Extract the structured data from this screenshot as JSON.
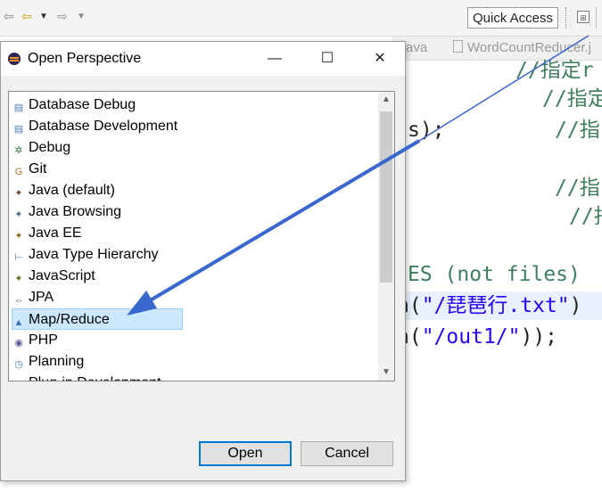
{
  "toolbar": {
    "quick_access": "Quick Access"
  },
  "editor": {
    "tabs": [
      "ava",
      "WordCountReducer.j"
    ],
    "lines": [
      {
        "text": "//指定r",
        "kind": "comment"
      },
      {
        "text": "//指定",
        "kind": "comment"
      },
      {
        "text": "s);",
        "kind": "plain"
      },
      {
        "text": "//指",
        "kind": "comment"
      },
      {
        "text": "//指",
        "kind": "comment"
      },
      {
        "text": "//指",
        "kind": "comment"
      },
      {
        "text": "ES (not files)",
        "kind": "comment"
      },
      {
        "text": "h(",
        "kind": "plain"
      },
      {
        "text": "\"/琵琶行.txt\"",
        "kind": "string"
      },
      {
        "text": ")",
        "kind": "plain"
      },
      {
        "text": "h(",
        "kind": "plain"
      },
      {
        "text": "\"/out1/\"",
        "kind": "string"
      },
      {
        "text": "));",
        "kind": "plain"
      }
    ]
  },
  "dialog": {
    "title": "Open Perspective",
    "minimize": "—",
    "maximize": "☐",
    "close": "✕",
    "perspectives": [
      {
        "label": "Database Debug",
        "icon": "database-debug-icon",
        "glyph": "▤",
        "color": "#4a7ab5"
      },
      {
        "label": "Database Development",
        "icon": "database-development-icon",
        "glyph": "▤",
        "color": "#4a7ab5"
      },
      {
        "label": "Debug",
        "icon": "bug-icon",
        "glyph": "✲",
        "color": "#3a7a3a"
      },
      {
        "label": "Git",
        "icon": "git-icon",
        "glyph": "G",
        "color": "#b07030"
      },
      {
        "label": "Java (default)",
        "icon": "java-icon",
        "glyph": "✦",
        "color": "#6b4a2a"
      },
      {
        "label": "Java Browsing",
        "icon": "java-browsing-icon",
        "glyph": "✦",
        "color": "#4a6a8a"
      },
      {
        "label": "Java EE",
        "icon": "java-ee-icon",
        "glyph": "✦",
        "color": "#8a6a2a"
      },
      {
        "label": "Java Type Hierarchy",
        "icon": "type-hierarchy-icon",
        "glyph": "⊢",
        "color": "#4a7ab5"
      },
      {
        "label": "JavaScript",
        "icon": "javascript-icon",
        "glyph": "✦",
        "color": "#6a6a2a"
      },
      {
        "label": "JPA",
        "icon": "jpa-icon",
        "glyph": "⇔",
        "color": "#555555"
      },
      {
        "label": "Map/Reduce",
        "icon": "elephant-icon",
        "glyph": "▲",
        "color": "#3b6fb6"
      },
      {
        "label": "PHP",
        "icon": "php-icon",
        "glyph": "◉",
        "color": "#5a5a9a"
      },
      {
        "label": "Planning",
        "icon": "planning-icon",
        "glyph": "◷",
        "color": "#3a7ab5"
      },
      {
        "label": "Plug-in Development",
        "icon": "plugin-icon",
        "glyph": "✦",
        "color": "#6a6a6a"
      }
    ],
    "selected_index": 10,
    "open_label": "Open",
    "cancel_label": "Cancel"
  },
  "colors": {
    "accent": "#0078d7",
    "selection": "#cce8ff",
    "arrow": "#3a66d0"
  }
}
